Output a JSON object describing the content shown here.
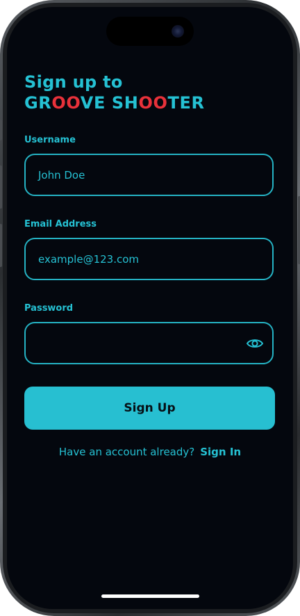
{
  "title": {
    "line1": "Sign up to",
    "line2_parts": [
      "GR",
      "OO",
      "VE SH",
      "OO",
      "TER"
    ]
  },
  "fields": {
    "username": {
      "label": "Username",
      "value": "John Doe"
    },
    "email": {
      "label": "Email Address",
      "value": "example@123.com"
    },
    "password": {
      "label": "Password",
      "value": ""
    }
  },
  "signup_button": {
    "label": "Sign Up"
  },
  "footer": {
    "text": "Have an account already?",
    "link": "Sign In"
  },
  "icons": {
    "password_toggle": "eye-icon"
  },
  "colors": {
    "accent": "#25c1d3",
    "highlight": "#e8313a",
    "background": "#04070e",
    "button_text": "#061016"
  }
}
